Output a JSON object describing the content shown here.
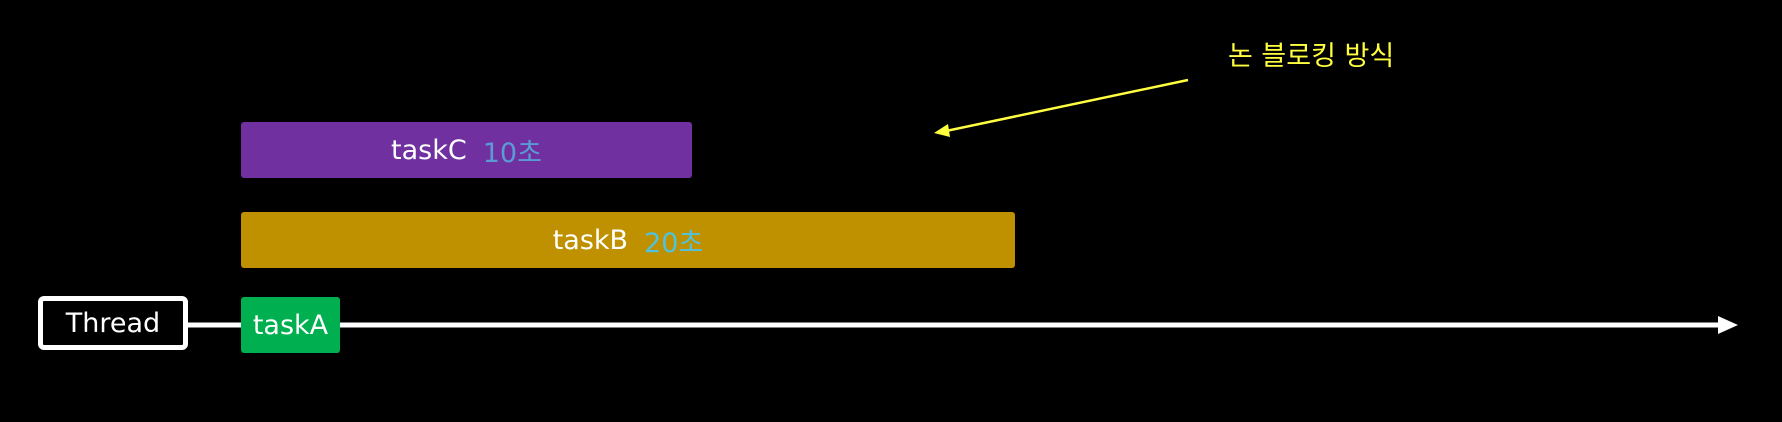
{
  "thread": {
    "label": "Thread"
  },
  "tasks": [
    {
      "name": "taskC",
      "duration": "10초",
      "color": "#7030a0",
      "duration_color": "#5b9bd5"
    },
    {
      "name": "taskB",
      "duration": "20초",
      "color": "#bf9000",
      "duration_color": "#4fc3dc"
    },
    {
      "name": "taskA",
      "duration": "",
      "color": "#00b050",
      "duration_color": ""
    }
  ],
  "annotation": {
    "text": "논 블로킹 방식",
    "color": "#ffff40"
  },
  "colors": {
    "background": "#000000",
    "timeline": "#ffffff"
  }
}
